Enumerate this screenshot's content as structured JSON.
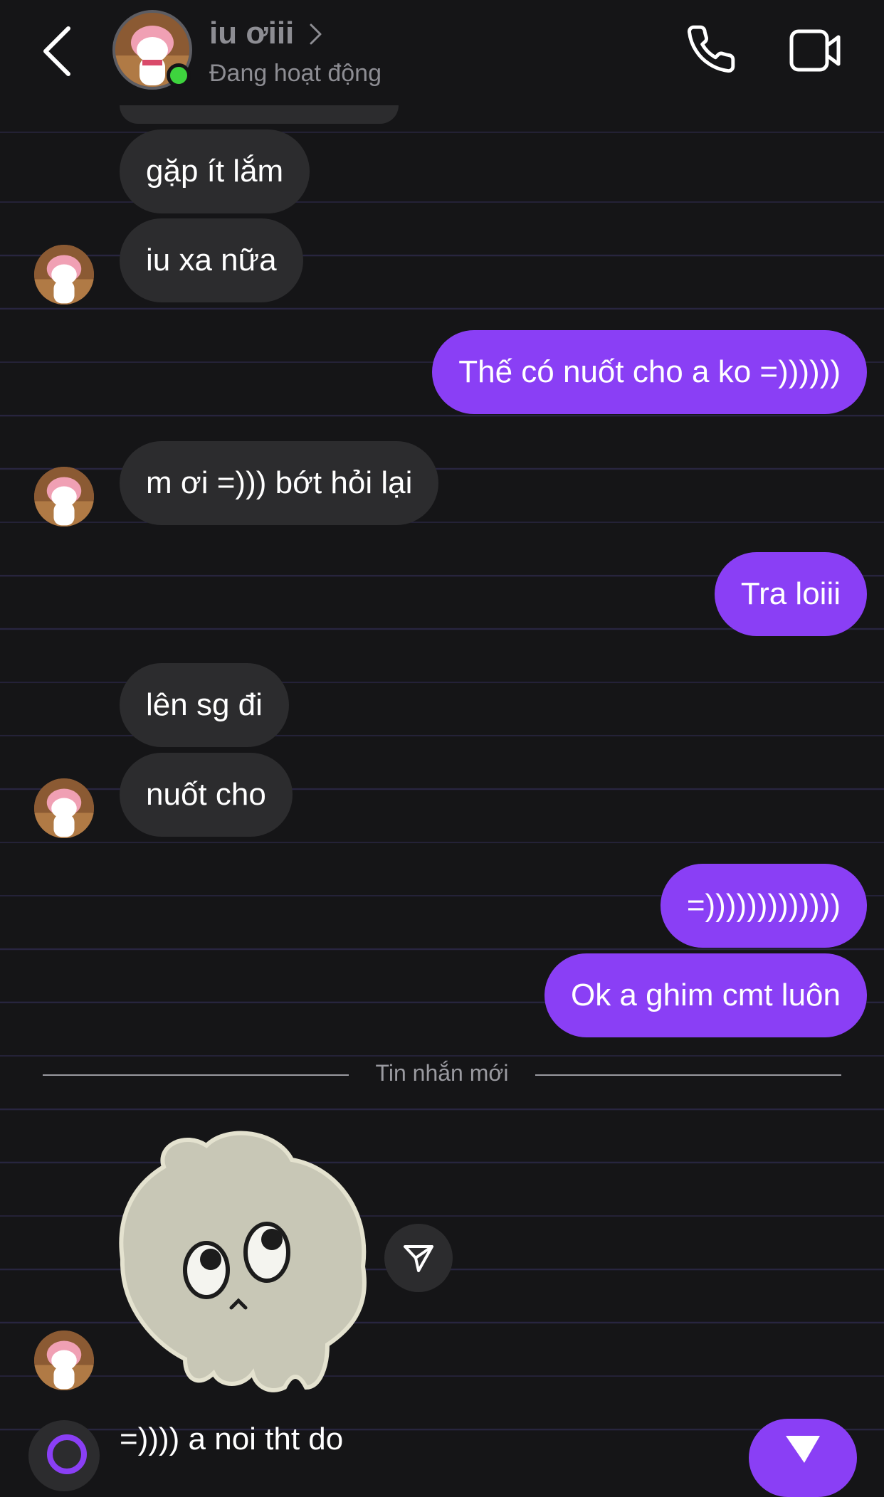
{
  "header": {
    "contact_name": "iu ơiii",
    "status": "Đang hoạt động",
    "icons": {
      "back": "chevron-left-icon",
      "phone": "phone-icon",
      "video": "video-camera-icon",
      "online": "online-dot-icon"
    }
  },
  "messages": [
    {
      "from": "them",
      "text": "gặp ít lắm"
    },
    {
      "from": "them",
      "text": "iu xa nữa"
    },
    {
      "from": "me",
      "text": "Thế có nuốt cho a ko =))))))"
    },
    {
      "from": "them",
      "text": "m ơi =))) bớt hỏi lại"
    },
    {
      "from": "me",
      "text": "Tra loiii"
    },
    {
      "from": "them",
      "text": "lên sg đi"
    },
    {
      "from": "them",
      "text": "nuốt cho"
    },
    {
      "from": "me",
      "text": "=)))))))))))))"
    },
    {
      "from": "me",
      "text": "Ok a ghim cmt luôn"
    }
  ],
  "divider": {
    "label": "Tin nhắn mới"
  },
  "sticker": {
    "icon": "skull-sticker-icon",
    "share_icon": "paper-plane-icon"
  },
  "composer": {
    "value": "=)))) a noi tht do",
    "send_icon": "send-icon"
  },
  "colors": {
    "background": "#151517",
    "incoming_bubble": "#2c2c2e",
    "outgoing_bubble": "#8a3ff5",
    "online": "#3ed43e",
    "muted_text": "#8d8d93"
  }
}
